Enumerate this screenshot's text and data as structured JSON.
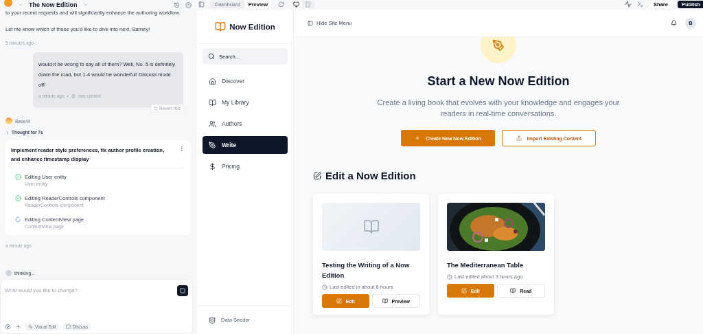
{
  "topbar": {
    "project": "The Now Edition",
    "tabs": [
      {
        "label": "Dashboard",
        "selected": false
      },
      {
        "label": "Preview",
        "selected": true
      }
    ],
    "devices": [
      {
        "kind": "desktop",
        "selected": true
      },
      {
        "kind": "mobile",
        "selected": false
      }
    ],
    "share": "Share",
    "publish": "Publish"
  },
  "chat": {
    "ai_lines": [
      "to your recent requests and will significantly enhance the authoring workflow.",
      "Let me know which of these you'd like to dive into next, Barney!"
    ],
    "ai_time": "5 minutes ago",
    "user_message": {
      "text": "would it be wrong to say all of them? Well, No. 5 is definitely down the road, but 1-4 would be wonderful! Discuss mode off!",
      "time": "a minute ago",
      "separator": "•",
      "context": "see context",
      "revert": "Revert this"
    },
    "bot_name": "Base44",
    "thought": "Thought for 7s",
    "task": {
      "title": "Implement reader style preferences, fix author profile creation, and enhance timestamp display",
      "steps": [
        {
          "label": "Editing User entity",
          "detail": "User entity",
          "done": true
        },
        {
          "label": "Editing ReaderControls component",
          "detail": "ReaderControls component",
          "done": true
        },
        {
          "label": "Editing ContentView page",
          "detail": "ContentView page",
          "done": false
        }
      ]
    },
    "task_time": "a minute ago",
    "status": "thinking...",
    "input": {
      "placeholder": "What would you like to change?"
    },
    "tools": [
      {
        "label": "Visual Edit",
        "kind": "visual"
      },
      {
        "label": "Discuss",
        "kind": "discuss"
      }
    ]
  },
  "site": {
    "brand": "Now Edition",
    "search": {
      "placeholder": "Search..."
    },
    "nav": [
      {
        "label": "Discover",
        "kind": "home",
        "selected": false
      },
      {
        "label": "My Library",
        "kind": "book",
        "selected": false
      },
      {
        "label": "Authors",
        "kind": "users",
        "selected": false
      },
      {
        "label": "Write",
        "kind": "pen",
        "selected": true
      },
      {
        "label": "Pricing",
        "kind": "dollar",
        "selected": false
      }
    ],
    "footer": "Data Seeder",
    "hide_menu": "Hide Site Menu",
    "avatar": "B",
    "hero": {
      "title": "Start a New Now Edition",
      "subtitle": "Create a living book that evolves with your knowledge and engages your readers in real-time conversations.",
      "primary": "Create New Now Edition",
      "secondary": "Import Existing Content"
    },
    "section_title": "Edit a Now Edition",
    "cards": [
      {
        "kind": "placeholder",
        "title": "Testing the Writing of a Now Edition",
        "edited": "Last edited in about 6 hours",
        "actions": [
          "Edit",
          "Preview"
        ]
      },
      {
        "kind": "picture",
        "title": "The Mediterranean Table",
        "edited": "Last edited about 3 hours ago",
        "actions": [
          "Edit",
          "Read"
        ]
      }
    ]
  }
}
